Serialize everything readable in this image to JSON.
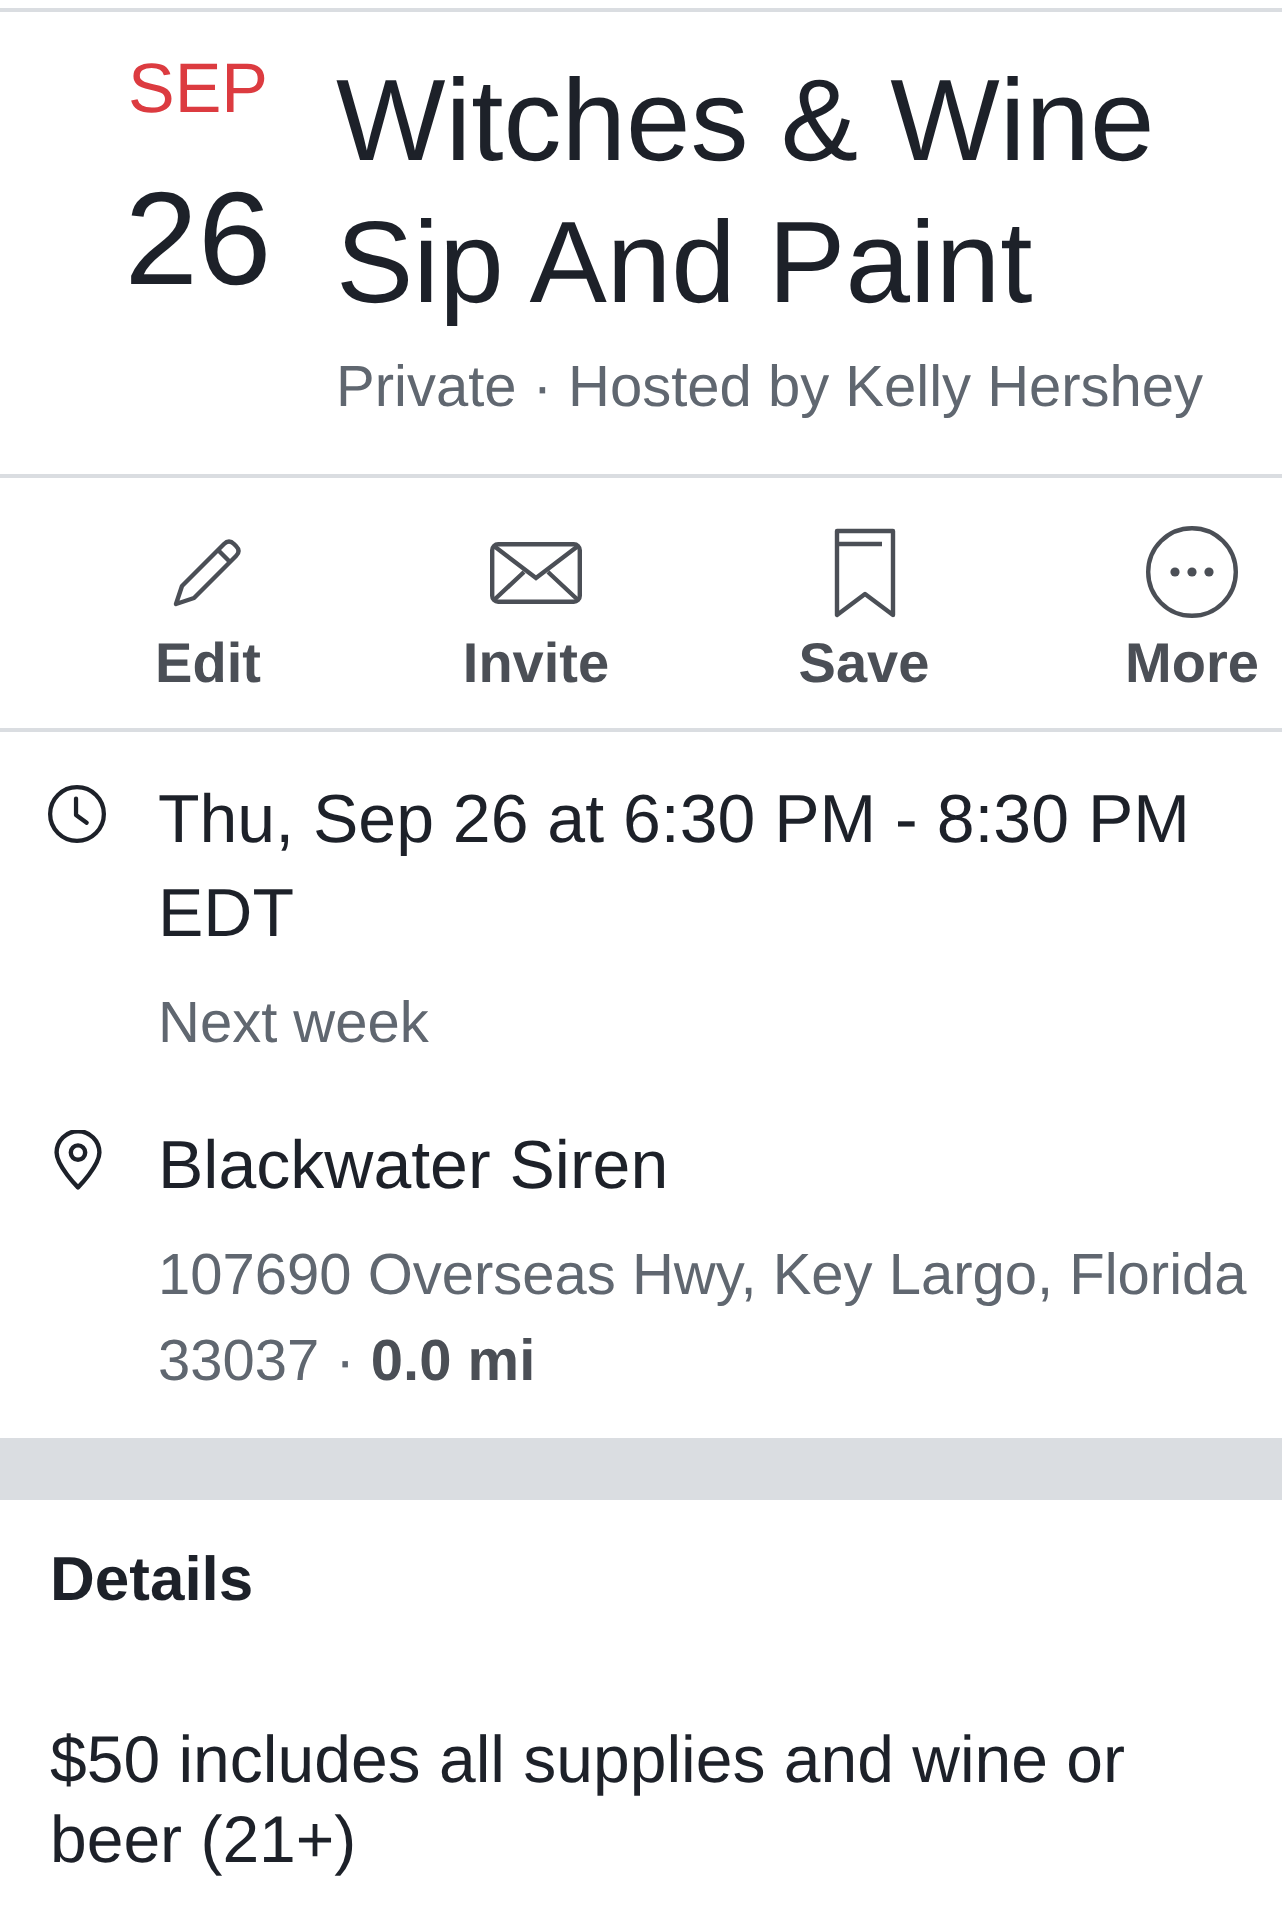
{
  "event": {
    "date": {
      "month": "SEP",
      "day": "26"
    },
    "title": "Witches & Wine Sip And Paint",
    "subtitle": "Private · Hosted by Kelly Hershey"
  },
  "actions": [
    {
      "label": "Edit"
    },
    {
      "label": "Invite"
    },
    {
      "label": "Save"
    },
    {
      "label": "More"
    }
  ],
  "info": [
    {
      "kind": "time",
      "primary": "Thu, Sep 26 at 6:30 PM - 8:30 PM EDT",
      "secondary": "Next week"
    },
    {
      "kind": "location",
      "primary": "Blackwater Siren",
      "secondary": "107690 Overseas Hwy, Key Largo, Florida 33037 · **0.0 mi**"
    }
  ],
  "details": {
    "heading": "Details",
    "text": "$50 includes all supplies and wine or beer (21+)"
  }
}
